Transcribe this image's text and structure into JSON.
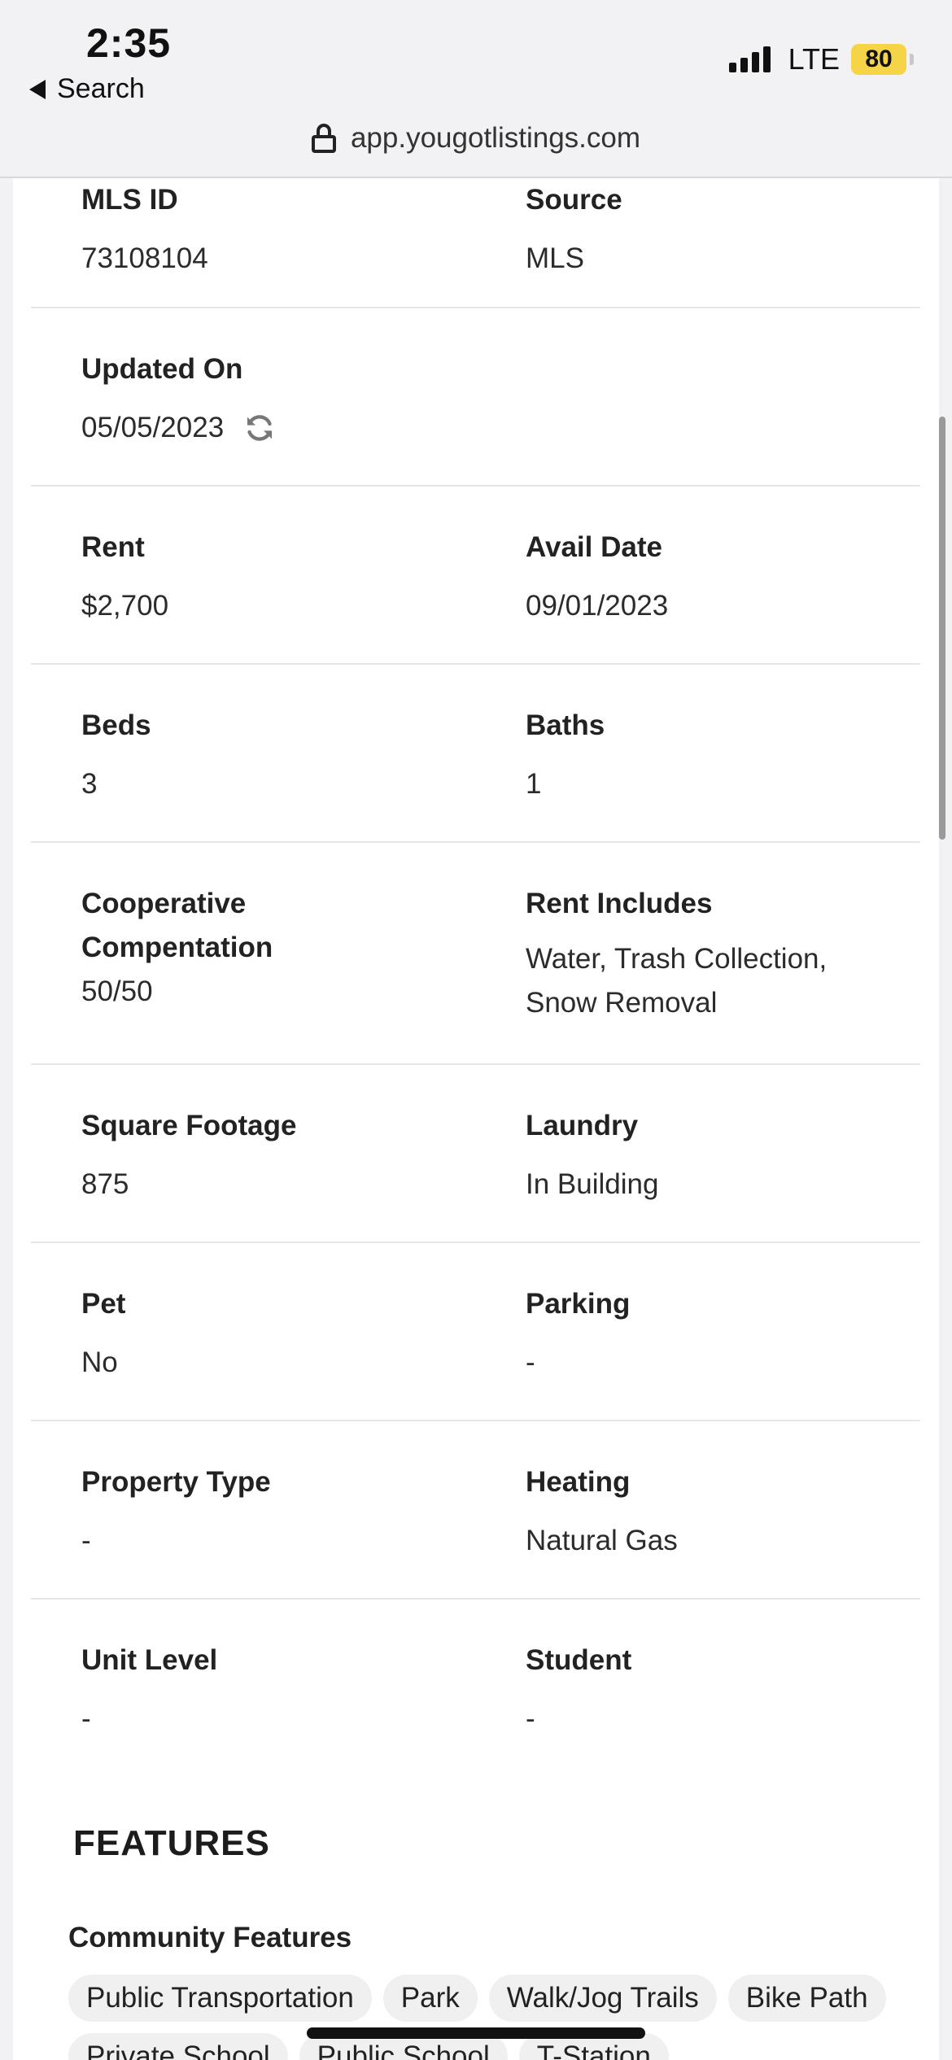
{
  "status_bar": {
    "time": "2:35",
    "back_label": "Search",
    "network": "LTE",
    "battery": "80"
  },
  "browser": {
    "url": "app.yougotlistings.com"
  },
  "details": {
    "mls_id": {
      "label": "MLS ID",
      "value": "73108104"
    },
    "source": {
      "label": "Source",
      "value": "MLS"
    },
    "updated_on": {
      "label": "Updated On",
      "value": "05/05/2023"
    },
    "rent": {
      "label": "Rent",
      "value": "$2,700"
    },
    "avail_date": {
      "label": "Avail Date",
      "value": "09/01/2023"
    },
    "beds": {
      "label": "Beds",
      "value": "3"
    },
    "baths": {
      "label": "Baths",
      "value": "1"
    },
    "cooperative": {
      "label": "Cooperative Compentation",
      "value": "50/50"
    },
    "rent_includes": {
      "label": "Rent Includes",
      "value": "Water, Trash Collection, Snow Removal"
    },
    "square_footage": {
      "label": "Square Footage",
      "value": "875"
    },
    "laundry": {
      "label": "Laundry",
      "value": "In Building"
    },
    "pet": {
      "label": "Pet",
      "value": "No"
    },
    "parking": {
      "label": "Parking",
      "value": "-"
    },
    "property_type": {
      "label": "Property Type",
      "value": "-"
    },
    "heating": {
      "label": "Heating",
      "value": "Natural Gas"
    },
    "unit_level": {
      "label": "Unit Level",
      "value": "-"
    },
    "student": {
      "label": "Student",
      "value": "-"
    }
  },
  "features": {
    "title": "FEATURES",
    "community_label": "Community Features",
    "community_chips": [
      "Public Transportation",
      "Park",
      "Walk/Jog Trails",
      "Bike Path",
      "Private School",
      "Public School",
      "T-Station"
    ]
  }
}
